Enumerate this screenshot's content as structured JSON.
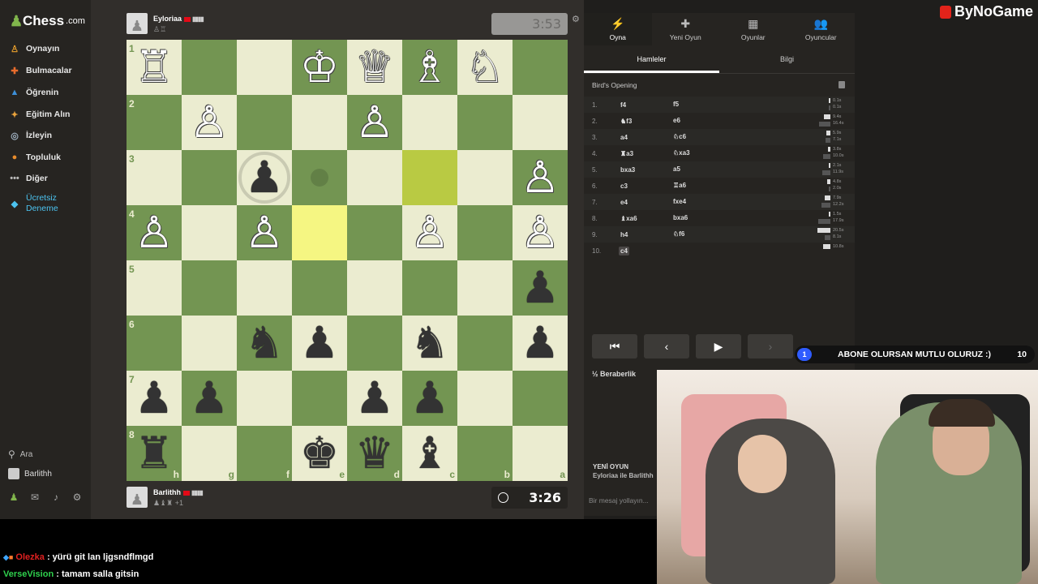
{
  "sidebar": {
    "logo": "Chess",
    "logo_suffix": ".com",
    "items": [
      {
        "label": "Oynayın",
        "icon": "pawn-play-icon",
        "color": "#e89f2c"
      },
      {
        "label": "Bulmacalar",
        "icon": "puzzle-icon",
        "color": "#e86c2c"
      },
      {
        "label": "Öğrenin",
        "icon": "graduation-cap-icon",
        "color": "#3d8fd8"
      },
      {
        "label": "Eğitim Alın",
        "icon": "coach-icon",
        "color": "#e8a23c"
      },
      {
        "label": "İzleyin",
        "icon": "binoculars-icon",
        "color": "#9fb0c0"
      },
      {
        "label": "Topluluk",
        "icon": "community-icon",
        "color": "#e88c2c"
      },
      {
        "label": "Diğer",
        "icon": "more-icon",
        "color": "#bbbbbb"
      },
      {
        "label": "Ücretsiz Deneme",
        "icon": "diamond-icon",
        "color": "#4cc3f0"
      }
    ],
    "search_label": "Ara",
    "user_label": "Barlithh"
  },
  "top_player": {
    "name": "Eyloriaa",
    "captured": "♙♖",
    "clock": "3:53"
  },
  "bottom_player": {
    "name": "Barlithh",
    "captured": "♟♝♜",
    "plus": "+1",
    "clock": "3:26"
  },
  "board": {
    "ranks": [
      "1",
      "2",
      "3",
      "4",
      "5",
      "6",
      "7",
      "8"
    ],
    "files": [
      "h",
      "g",
      "f",
      "e",
      "d",
      "c",
      "b",
      "a"
    ],
    "rows": [
      [
        "♖w",
        "",
        "",
        "♔w",
        "♕w",
        "♗w",
        "♘w",
        ""
      ],
      [
        "",
        "♙w",
        "",
        "",
        "♙w",
        "",
        "",
        ""
      ],
      [
        "",
        "",
        "♟b*",
        "dot",
        "",
        "hl",
        "",
        "♙w"
      ],
      [
        "♙w",
        "",
        "♙w",
        "hl",
        "",
        "♙w",
        "",
        "♙w"
      ],
      [
        "",
        "",
        "",
        "",
        "",
        "",
        "",
        "♟b"
      ],
      [
        "",
        "",
        "♞b",
        "♟b",
        "",
        "♞b",
        "",
        "♟b"
      ],
      [
        "♟b",
        "♟b",
        "",
        "",
        "♟b",
        "♟b",
        "",
        ""
      ],
      [
        "♜b",
        "",
        "",
        "♚b",
        "♛b",
        "♝b",
        "",
        ""
      ]
    ]
  },
  "panel": {
    "tabs": [
      {
        "label": "Oyna",
        "icon": "lightning-icon"
      },
      {
        "label": "Yeni Oyun",
        "icon": "plus-icon"
      },
      {
        "label": "Oyunlar",
        "icon": "games-icon"
      },
      {
        "label": "Oyuncular",
        "icon": "players-icon"
      }
    ],
    "subtabs": [
      "Hamleler",
      "Bilgi"
    ],
    "opening": "Bird's Opening",
    "moves": [
      {
        "n": "1.",
        "w": "f4",
        "b": "f5",
        "tw": "0.1s",
        "tb": "0.1s",
        "bw": 2,
        "bb": 2
      },
      {
        "n": "2.",
        "w": "♞f3",
        "b": "e6",
        "tw": "9.4s",
        "tb": "16.4s",
        "bw": 8,
        "bb": 14
      },
      {
        "n": "3.",
        "w": "a4",
        "b": "♘c6",
        "tw": "5.9s",
        "tb": "7.1s",
        "bw": 5,
        "bb": 6
      },
      {
        "n": "4.",
        "w": "♜a3",
        "b": "♘xa3",
        "tw": "3.8s",
        "tb": "10.0s",
        "bw": 3,
        "bb": 9
      },
      {
        "n": "5.",
        "w": "bxa3",
        "b": "a5",
        "tw": "2.1s",
        "tb": "11.9s",
        "bw": 2,
        "bb": 10
      },
      {
        "n": "6.",
        "w": "c3",
        "b": "♖a6",
        "tw": "4.8s",
        "tb": "2.0s",
        "bw": 4,
        "bb": 2
      },
      {
        "n": "7.",
        "w": "e4",
        "b": "fxe4",
        "tw": "7.9s",
        "tb": "12.2s",
        "bw": 7,
        "bb": 11
      },
      {
        "n": "8.",
        "w": "♝xa6",
        "b": "bxa6",
        "tw": "1.5s",
        "tb": "17.9s",
        "bw": 2,
        "bb": 15
      },
      {
        "n": "9.",
        "w": "h4",
        "b": "♘f6",
        "tw": "20.5s",
        "tb": "8.1s",
        "bw": 16,
        "bb": 7
      },
      {
        "n": "10.",
        "w": "c4",
        "b": "",
        "tw": "10.8s",
        "tb": "",
        "bw": 9,
        "bb": 0
      }
    ],
    "draw_label": "Beraberlik",
    "new_game_title": "YENİ OYUN",
    "new_game_sub": "Eyloriaa ile Barlithh",
    "chat_placeholder": "Bir mesaj yollayın..."
  },
  "stream": {
    "brand": "ByNoGame",
    "banner_count": "1",
    "banner_text": "ABONE OLURSAN MUTLU OLURUZ :)",
    "banner_goal": "10",
    "chat": [
      {
        "user": "Olezka",
        "msg": ": yürü git lan ljgsndflmgd"
      },
      {
        "user": "VerseVision",
        "msg": ": tamam salla gitsin"
      }
    ]
  }
}
